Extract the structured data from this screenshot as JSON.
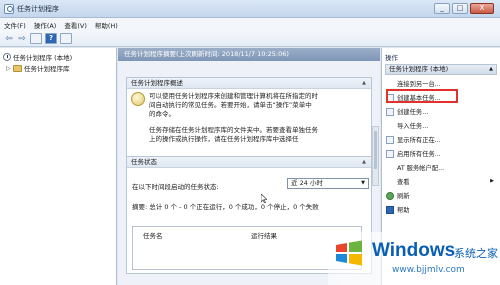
{
  "window": {
    "title": "任务计划程序",
    "controls": [
      "_",
      "□",
      "X"
    ]
  },
  "menu": [
    "文件(F)",
    "操作(A)",
    "查看(V)",
    "帮助(H)"
  ],
  "tree": {
    "root": "任务计划程序 (本地)",
    "child": "任务计划程序库"
  },
  "center": {
    "header": "任务计划程序摘要(上次刷新时间: 2018/11/7 10:25:06)",
    "overview": {
      "title": "任务计划程序概述",
      "p1": [
        "可以使用任务计划程序来创建和管理计算机将在所指定的时",
        "间自动执行的常见任务。若要开始，请单击“操作”菜单中",
        "的命令。"
      ],
      "p2": [
        "任务存储在任务计划程序库的文件夹中。若要查看单独任务",
        "上的操作或执行操作，请在任务计划程序库中选择任"
      ]
    },
    "status": {
      "title": "任务状态",
      "period_label": "在以下时间段启动的任务状态:",
      "period_value": "近 24 小时",
      "summary": "摘要: 总计 0 个 - 0 个正在运行，0 个成功，0 个停止，0 个失败",
      "columns": [
        "任务名",
        "运行结果"
      ]
    }
  },
  "actions": {
    "title": "操作",
    "group": "任务计划程序 (本地)",
    "items": [
      "连接到另一台...",
      "创建基本任务...",
      "创建任务...",
      "导入任务...",
      "显示所有正在...",
      "启用所有任务...",
      "AT 服务帐户配...",
      "查看",
      "刷新",
      "帮助"
    ]
  },
  "watermark": {
    "title": "Windows",
    "subtitle": "系统之家",
    "url": "www.bjjmlv.com"
  },
  "colors": {
    "highlight": "#e0312b",
    "header": "#7e96b6",
    "brand": "#0a5fb5"
  }
}
